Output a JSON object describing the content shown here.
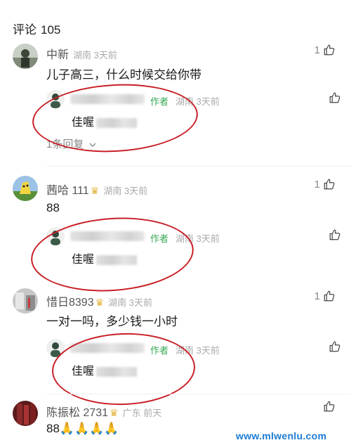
{
  "header": {
    "title": "评论",
    "count": "105"
  },
  "comments": [
    {
      "user": "中新",
      "badge": "",
      "location": "湖南 3天前",
      "likes": "1",
      "text": "儿子高三，什么时候交给你带",
      "reply": {
        "author_tag": "作者",
        "location": "湖南 3天前",
        "text": "佳喔"
      },
      "more_replies": "1条回复",
      "more_icon": "chevron-down-icon"
    },
    {
      "user": "茜哈 111",
      "badge": "crown-badge-icon",
      "location": "湖南 3天前",
      "likes": "1",
      "text": "88",
      "reply": {
        "author_tag": "作者",
        "location": "湖南 3天前",
        "text": "佳喔"
      }
    },
    {
      "user": "惜日8393",
      "badge": "crown-badge-icon",
      "location": "湖南 3天前",
      "likes": "1",
      "text": "一对一吗，多少钱一小时",
      "reply": {
        "author_tag": "作者",
        "location": "湖南 3天前",
        "text": "佳喔"
      }
    },
    {
      "user": "陈振松 2731",
      "badge": "crown-badge-icon",
      "location": "广东 前天",
      "likes": "",
      "text": "88🙏🙏🙏🙏"
    }
  ],
  "watermark": "www.mlwenlu.com",
  "colors": {
    "author_green": "#34a853",
    "circle_red": "#c81f25",
    "watermark_blue": "#1b7bd4",
    "badge_gold": "#e2b33b"
  }
}
